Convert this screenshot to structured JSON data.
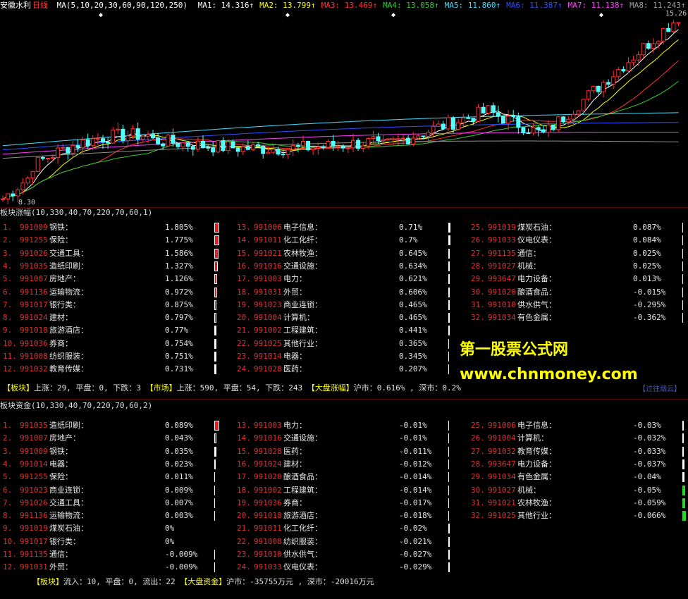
{
  "header": {
    "name": "安徽水利",
    "period": "日线",
    "ma_def": "MA(5,10,20,30,60,90,120,250)",
    "mas": [
      {
        "label": "MA1:",
        "value": "14.316",
        "arrow": "↑",
        "color": "#ffffff"
      },
      {
        "label": "MA2:",
        "value": "13.799",
        "arrow": "↑",
        "color": "#ffff00"
      },
      {
        "label": "MA3:",
        "value": "13.469",
        "arrow": "↑",
        "color": "#ff3333"
      },
      {
        "label": "MA4:",
        "value": "13.058",
        "arrow": "↑",
        "color": "#33cc33"
      },
      {
        "label": "MA5:",
        "value": "11.860",
        "arrow": "↑",
        "color": "#40e0ff"
      },
      {
        "label": "MA6:",
        "value": "11.387",
        "arrow": "↑",
        "color": "#3050ff"
      },
      {
        "label": "MA7:",
        "value": "11.138",
        "arrow": "↑",
        "color": "#ff40ff"
      },
      {
        "label": "MA8:",
        "value": "11.243",
        "arrow": "↑",
        "color": "#a0a0a0"
      }
    ]
  },
  "chart_data": {
    "type": "candlestick",
    "price_max_label": "15.26",
    "price_min_label": "8.30",
    "ylim": [
      8.3,
      15.26
    ],
    "colors": {
      "up": "#ff3232",
      "down": "#54ffff",
      "ma1": "#ffffff",
      "ma2": "#ffff00",
      "ma3": "#ff3333",
      "ma4": "#33cc33",
      "ma5": "#40e0ff",
      "ma6": "#3050ff",
      "ma7": "#ff40ff",
      "ma8": "#909090"
    }
  },
  "panel1": {
    "title": "板块涨幅(10,330,40,70,220,70,60,1)",
    "columns": [
      [
        {
          "no": "1.",
          "code": "991009",
          "name": "钢铁：",
          "value": "1.805%",
          "pct": 1.805
        },
        {
          "no": "2.",
          "code": "991255",
          "name": "保险：",
          "value": "1.775%",
          "pct": 1.775
        },
        {
          "no": "3.",
          "code": "991026",
          "name": "交通工具：",
          "value": "1.586%",
          "pct": 1.586
        },
        {
          "no": "4.",
          "code": "991035",
          "name": "造纸印刷：",
          "value": "1.327%",
          "pct": 1.327
        },
        {
          "no": "5.",
          "code": "991007",
          "name": "房地产：",
          "value": "1.126%",
          "pct": 1.126
        },
        {
          "no": "6.",
          "code": "991136",
          "name": "运输物流：",
          "value": "0.972%",
          "pct": 0.972
        },
        {
          "no": "7.",
          "code": "991017",
          "name": "银行类：",
          "value": "0.875%",
          "pct": 0.875
        },
        {
          "no": "8.",
          "code": "991024",
          "name": "建材：",
          "value": "0.797%",
          "pct": 0.797
        },
        {
          "no": "9.",
          "code": "991018",
          "name": "旅游酒店：",
          "value": "0.77%",
          "pct": 0.77
        },
        {
          "no": "10.",
          "code": "991036",
          "name": "券商：",
          "value": "0.754%",
          "pct": 0.754
        },
        {
          "no": "11.",
          "code": "991008",
          "name": "纺织服装：",
          "value": "0.751%",
          "pct": 0.751
        },
        {
          "no": "12.",
          "code": "991032",
          "name": "教育传媒：",
          "value": "0.731%",
          "pct": 0.731
        }
      ],
      [
        {
          "no": "13.",
          "code": "991006",
          "name": "电子信息：",
          "value": "0.71%",
          "pct": 0.71
        },
        {
          "no": "14.",
          "code": "991011",
          "name": "化工化纤：",
          "value": "0.7%",
          "pct": 0.7
        },
        {
          "no": "15.",
          "code": "991021",
          "name": "农林牧渔：",
          "value": "0.645%",
          "pct": 0.645
        },
        {
          "no": "16.",
          "code": "991016",
          "name": "交通设施：",
          "value": "0.634%",
          "pct": 0.634
        },
        {
          "no": "17.",
          "code": "991003",
          "name": "电力：",
          "value": "0.621%",
          "pct": 0.621
        },
        {
          "no": "18.",
          "code": "991031",
          "name": "外贸：",
          "value": "0.606%",
          "pct": 0.606
        },
        {
          "no": "19.",
          "code": "991023",
          "name": "商业连锁：",
          "value": "0.465%",
          "pct": 0.465
        },
        {
          "no": "20.",
          "code": "991004",
          "name": "计算机：",
          "value": "0.465%",
          "pct": 0.465
        },
        {
          "no": "21.",
          "code": "991002",
          "name": "工程建筑：",
          "value": "0.441%",
          "pct": 0.441
        },
        {
          "no": "22.",
          "code": "991025",
          "name": "其他行业：",
          "value": "0.365%",
          "pct": 0.365
        },
        {
          "no": "23.",
          "code": "991014",
          "name": "电器：",
          "value": "0.345%",
          "pct": 0.345
        },
        {
          "no": "24.",
          "code": "991028",
          "name": "医药：",
          "value": "0.207%",
          "pct": 0.207
        }
      ],
      [
        {
          "no": "25.",
          "code": "991019",
          "name": "煤炭石油：",
          "value": "0.087%",
          "pct": 0.087
        },
        {
          "no": "26.",
          "code": "991033",
          "name": "仪电仪表：",
          "value": "0.084%",
          "pct": 0.084
        },
        {
          "no": "27.",
          "code": "991135",
          "name": "通信：",
          "value": "0.025%",
          "pct": 0.025
        },
        {
          "no": "28.",
          "code": "991027",
          "name": "机械：",
          "value": "0.025%",
          "pct": 0.025
        },
        {
          "no": "29.",
          "code": "993647",
          "name": "电力设备：",
          "value": "0.013%",
          "pct": 0.013
        },
        {
          "no": "30.",
          "code": "991020",
          "name": "酿酒食品：",
          "value": "-0.015%",
          "pct": -0.015
        },
        {
          "no": "31.",
          "code": "991010",
          "name": "供水供气：",
          "value": "-0.295%",
          "pct": -0.295
        },
        {
          "no": "32.",
          "code": "991034",
          "name": "有色金属：",
          "value": "-0.362%",
          "pct": -0.362
        }
      ]
    ],
    "summary": {
      "label1": "【板块】",
      "up": "上涨：29",
      "flat": "平盘：0",
      "down": "下跌：3",
      "label2": "【市场】",
      "m_up": "上涨：590",
      "m_flat": "平盘：54",
      "m_down": "下跌：243",
      "label3": "【大盘涨幅】",
      "sh": "沪市：0.616%",
      "sz": "深市：0.2%"
    }
  },
  "panel2": {
    "title": "板块资金(10,330,40,70,220,70,60,2)",
    "columns": [
      [
        {
          "no": "1.",
          "code": "991035",
          "name": "造纸印刷：",
          "value": "0.089%",
          "pct": 0.089
        },
        {
          "no": "2.",
          "code": "991007",
          "name": "房地产：",
          "value": "0.043%",
          "pct": 0.043
        },
        {
          "no": "3.",
          "code": "991009",
          "name": "钢铁：",
          "value": "0.035%",
          "pct": 0.035
        },
        {
          "no": "4.",
          "code": "991014",
          "name": "电器：",
          "value": "0.023%",
          "pct": 0.023
        },
        {
          "no": "5.",
          "code": "991255",
          "name": "保险：",
          "value": "0.011%",
          "pct": 0.011
        },
        {
          "no": "6.",
          "code": "991023",
          "name": "商业连锁：",
          "value": "0.009%",
          "pct": 0.009
        },
        {
          "no": "7.",
          "code": "991026",
          "name": "交通工具：",
          "value": "0.007%",
          "pct": 0.007
        },
        {
          "no": "8.",
          "code": "991136",
          "name": "运输物流：",
          "value": "0.003%",
          "pct": 0.003
        },
        {
          "no": "9.",
          "code": "991019",
          "name": "煤炭石油：",
          "value": "0%",
          "pct": 0
        },
        {
          "no": "10.",
          "code": "991017",
          "name": "银行类：",
          "value": "0%",
          "pct": 0
        },
        {
          "no": "11.",
          "code": "991135",
          "name": "通信：",
          "value": "-0.009%",
          "pct": -0.009
        },
        {
          "no": "12.",
          "code": "991031",
          "name": "外贸：",
          "value": "-0.009%",
          "pct": -0.009
        }
      ],
      [
        {
          "no": "13.",
          "code": "991003",
          "name": "电力：",
          "value": "-0.01%",
          "pct": -0.01
        },
        {
          "no": "14.",
          "code": "991016",
          "name": "交通设施：",
          "value": "-0.01%",
          "pct": -0.01
        },
        {
          "no": "15.",
          "code": "991028",
          "name": "医药：",
          "value": "-0.011%",
          "pct": -0.011
        },
        {
          "no": "16.",
          "code": "991024",
          "name": "建材：",
          "value": "-0.012%",
          "pct": -0.012
        },
        {
          "no": "17.",
          "code": "991020",
          "name": "酿酒食品：",
          "value": "-0.014%",
          "pct": -0.014
        },
        {
          "no": "18.",
          "code": "991002",
          "name": "工程建筑：",
          "value": "-0.014%",
          "pct": -0.014
        },
        {
          "no": "19.",
          "code": "991036",
          "name": "券商：",
          "value": "-0.017%",
          "pct": -0.017
        },
        {
          "no": "20.",
          "code": "991018",
          "name": "旅游酒店：",
          "value": "-0.018%",
          "pct": -0.018
        },
        {
          "no": "21.",
          "code": "991011",
          "name": "化工化纤：",
          "value": "-0.02%",
          "pct": -0.02
        },
        {
          "no": "22.",
          "code": "991008",
          "name": "纺织服装：",
          "value": "-0.021%",
          "pct": -0.021
        },
        {
          "no": "23.",
          "code": "991010",
          "name": "供水供气：",
          "value": "-0.027%",
          "pct": -0.027
        },
        {
          "no": "24.",
          "code": "991033",
          "name": "仪电仪表：",
          "value": "-0.029%",
          "pct": -0.029
        }
      ],
      [
        {
          "no": "25.",
          "code": "991006",
          "name": "电子信息：",
          "value": "-0.03%",
          "pct": -0.03
        },
        {
          "no": "26.",
          "code": "991004",
          "name": "计算机：",
          "value": "-0.032%",
          "pct": -0.032
        },
        {
          "no": "27.",
          "code": "991032",
          "name": "教育传媒：",
          "value": "-0.033%",
          "pct": -0.033
        },
        {
          "no": "28.",
          "code": "993647",
          "name": "电力设备：",
          "value": "-0.037%",
          "pct": -0.037
        },
        {
          "no": "29.",
          "code": "991034",
          "name": "有色金属：",
          "value": "-0.04%",
          "pct": -0.04
        },
        {
          "no": "30.",
          "code": "991027",
          "name": "机械：",
          "value": "-0.05%",
          "pct": -0.05
        },
        {
          "no": "31.",
          "code": "991021",
          "name": "农林牧渔：",
          "value": "-0.059%",
          "pct": -0.059
        },
        {
          "no": "32.",
          "code": "991025",
          "name": "其他行业：",
          "value": "-0.066%",
          "pct": -0.066
        }
      ]
    ],
    "summary": {
      "label1": "【板块】",
      "inflow": "流入：10",
      "flat": "平盘：0",
      "outflow": "流出：22",
      "label2": "【大盘资金】",
      "sh": "沪市：-35755万元",
      "sz": "深市：-20016万元"
    }
  },
  "watermark": {
    "line1": "第一股票公式网",
    "line2": "www.chnmoney.com",
    "link": "【过往烟云】"
  }
}
